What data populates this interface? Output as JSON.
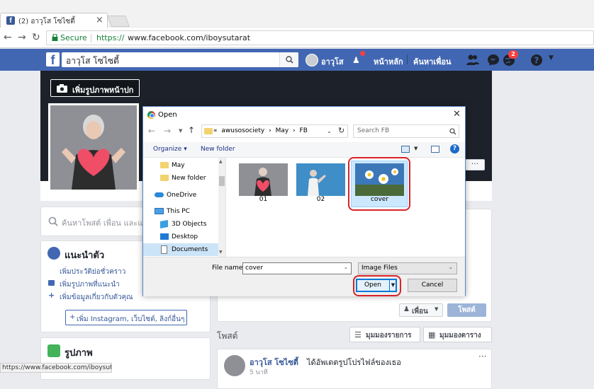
{
  "browser": {
    "tab_title": "(2) อาวุโส โซไซตี้",
    "tab_close": "×",
    "secure_label": "Secure",
    "url_scheme": "https://",
    "url_rest": "www.facebook.com/iboysutarat",
    "status_url": "https://www.facebook.com/iboysutarat#"
  },
  "fb_header": {
    "logo": "f",
    "search_value": "อาวุโส โซไซตี้",
    "profile_name": "อาวุโส",
    "home": "หน้าหลัก",
    "find_friends": "ค้นหาเพื่อน",
    "notification_count": "2",
    "brand_color": "#4267b2"
  },
  "cover": {
    "add_cover_label": "เพิ่มรูปภาพหน้าปก"
  },
  "left_column": {
    "post_search_placeholder": "ค้นหาโพสต์ เพื่อน และแท็ก",
    "intro_title": "แนะนำตัว",
    "intro_links": [
      "เพิ่มประวัติย่อชั่วคราว",
      "เพิ่มรูปภาพที่แนะนำ",
      "เพิ่มข้อมูลเกี่ยวกับตัวคุณ"
    ],
    "intro_button": "เพิ่ม Instagram, เว็บไซต์, ลิงก์อื่นๆ",
    "photos_title": "รูปภาพ"
  },
  "right_column": {
    "friend_button": "เพื่อน",
    "post_button": "โพสต์",
    "posts_label": "โพสต์",
    "list_view": "มุมมองรายการ",
    "grid_view": "มุมมองตาราง",
    "post_author": "อาวุโส โซไซตี้",
    "post_action": "ได้อัพเดตรูปโปรไฟล์ของเธอ",
    "post_time": "5 นาที"
  },
  "dialog": {
    "title": "Open",
    "close": "✕",
    "breadcrumb": [
      "«",
      "awusosociety",
      "May",
      "FB"
    ],
    "search_placeholder": "Search FB",
    "organize": "Organize",
    "new_folder": "New folder",
    "nav_items": [
      "May",
      "New folder",
      "OneDrive",
      "This PC",
      "3D Objects",
      "Desktop",
      "Documents"
    ],
    "files": [
      {
        "name": "01"
      },
      {
        "name": "02"
      },
      {
        "name": "cover"
      }
    ],
    "file_name_label": "File name:",
    "file_name_value": "cover",
    "file_type": "Image Files",
    "open_button": "Open",
    "cancel_button": "Cancel",
    "selection_color": "#cce8ff",
    "highlight_color": "#d8232a"
  }
}
